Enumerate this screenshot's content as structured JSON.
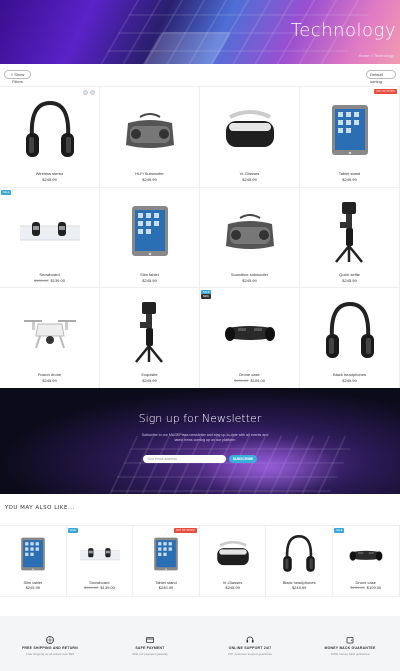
{
  "hero": {
    "title": "Technology",
    "breadcrumb": "Home > Technology"
  },
  "toolbar": {
    "filter_label": "≡ Show Filters",
    "sort_label": "Default sorting"
  },
  "products": [
    {
      "name": "Wireless stereo",
      "price": "$245.99",
      "old": "",
      "badge": "",
      "icon": "headphones-icon"
    },
    {
      "name": "Hi-Fi Subwoofer",
      "price": "$245.99",
      "old": "",
      "badge": "",
      "icon": "speaker-icon"
    },
    {
      "name": "Vr-Glasses",
      "price": "$245.99",
      "old": "",
      "badge": "",
      "icon": "vr-headset-icon"
    },
    {
      "name": "Tablet stand",
      "price": "$245.99",
      "old": "",
      "badge": "OUT OF STOCK",
      "icon": "tablet-icon"
    },
    {
      "name": "Snowboard",
      "price": "$139.00",
      "old": "$189.00",
      "badge": "SALE",
      "icon": "snowboard-icon"
    },
    {
      "name": "Slim tablet",
      "price": "$245.99",
      "old": "",
      "badge": "",
      "icon": "tablet-icon"
    },
    {
      "name": "Soundline subwoofer",
      "price": "$245.99",
      "old": "",
      "badge": "",
      "icon": "speaker-icon"
    },
    {
      "name": "Quick selfie",
      "price": "$245.99",
      "old": "",
      "badge": "",
      "icon": "gimbal-icon"
    },
    {
      "name": "Fusion drone",
      "price": "$245.99",
      "old": "",
      "badge": "",
      "icon": "drone-icon"
    },
    {
      "name": "Exquisite",
      "price": "$245.99",
      "old": "",
      "badge": "",
      "icon": "gimbal-icon"
    },
    {
      "name": "Drone case",
      "price": "$109.00",
      "old": "$139.00",
      "badge": "SALE",
      "icon": "hoverboard-icon"
    },
    {
      "name": "Black headphones",
      "price": "$245.99",
      "old": "",
      "badge": "",
      "icon": "headphones-icon"
    }
  ],
  "newsletter": {
    "title": "Sign up for Newsletter",
    "text": "Subscribe to our MAGEPlaza newsletter and stay up-to-date with all events and latest news coming up on our platform",
    "placeholder": "Your email address",
    "button": "SUBSCRIBE"
  },
  "related": {
    "heading": "YOU MAY ALSO LIKE...",
    "items": [
      {
        "name": "Slim tablet",
        "price": "$245.99",
        "old": "",
        "badge": "",
        "icon": "tablet-icon"
      },
      {
        "name": "Snowboard",
        "price": "$139.00",
        "old": "$189.00",
        "badge": "SALE",
        "icon": "snowboard-icon"
      },
      {
        "name": "Tablet stand",
        "price": "$245.99",
        "old": "",
        "badge": "OUT OF STOCK",
        "icon": "tablet-icon"
      },
      {
        "name": "Vr-Glasses",
        "price": "$245.99",
        "old": "",
        "badge": "",
        "icon": "vr-headset-icon"
      },
      {
        "name": "Black headphones",
        "price": "$245.99",
        "old": "",
        "badge": "",
        "icon": "headphones-icon"
      },
      {
        "name": "Drone case",
        "price": "$109.00",
        "old": "$139.00",
        "badge": "SALE",
        "icon": "hoverboard-icon"
      }
    ]
  },
  "features": [
    {
      "title": "FREE SHIPPING AND RETURN",
      "desc": "Free shipping on all orders over $99",
      "icon": "globe-icon"
    },
    {
      "title": "SAFE PAYMENT",
      "desc": "With our payment gateway",
      "icon": "card-icon"
    },
    {
      "title": "ONLINE SUPPORT 24/7",
      "desc": "24/7 customer support guarantee",
      "icon": "headset-icon"
    },
    {
      "title": "MONEY BACK GUARANTEE",
      "desc": "100% money back guarantee",
      "icon": "wallet-icon"
    }
  ],
  "colors": {
    "sale": "#e74c3c",
    "new": "#3aa7d8",
    "accent": "#3ab0d8"
  }
}
